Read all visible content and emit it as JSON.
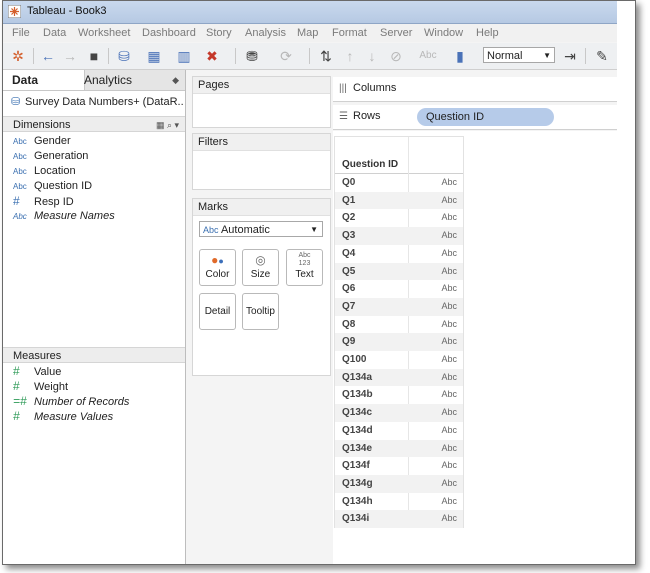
{
  "window": {
    "title": "Tableau - Book3"
  },
  "menu": [
    "File",
    "Data",
    "Worksheet",
    "Dashboard",
    "Story",
    "Analysis",
    "Map",
    "Format",
    "Server",
    "Window",
    "Help"
  ],
  "toolbar": {
    "fit_value": "Normal",
    "icons": [
      "tableau-logo-icon",
      "back-icon",
      "forward-icon",
      "save-icon",
      "new-datasource-icon",
      "new-worksheet-icon",
      "duplicate-sheet-icon",
      "clear-sheet-icon",
      "datasource-connect-icon",
      "refresh-icon",
      "swap-icon",
      "sort-ascending-icon",
      "sort-descending-icon",
      "group-icon",
      "labels-icon",
      "show-me-icon",
      "fit-icon",
      "pen-icon"
    ]
  },
  "left": {
    "tabs": {
      "data": "Data",
      "analytics": "Analytics"
    },
    "datasource": "Survey Data Numbers+ (DataR...",
    "dimensions_header": "Dimensions",
    "dimensions": [
      {
        "type": "Abc",
        "name": "Gender",
        "italic": false
      },
      {
        "type": "Abc",
        "name": "Generation",
        "italic": false
      },
      {
        "type": "Abc",
        "name": "Location",
        "italic": false
      },
      {
        "type": "Abc",
        "name": "Question ID",
        "italic": false
      },
      {
        "type": "#",
        "name": "Resp ID",
        "italic": false
      },
      {
        "type": "Abc",
        "name": "Measure Names",
        "italic": true
      }
    ],
    "measures_header": "Measures",
    "measures": [
      {
        "type": "#",
        "name": "Value",
        "italic": false
      },
      {
        "type": "#",
        "name": "Weight",
        "italic": false
      },
      {
        "type": "=#",
        "name": "Number of Records",
        "italic": true
      },
      {
        "type": "#",
        "name": "Measure Values",
        "italic": true
      }
    ]
  },
  "cards": {
    "pages": "Pages",
    "filters": "Filters",
    "marks": "Marks",
    "mark_type_icon": "Abc",
    "mark_type": "Automatic",
    "buttons": {
      "color": "Color",
      "size": "Size",
      "text": "Text",
      "detail": "Detail",
      "tooltip": "Tooltip"
    },
    "text_icon_lines": [
      "Abc",
      "123"
    ]
  },
  "shelves": {
    "columns_label": "Columns",
    "rows_label": "Rows",
    "rows_pill": "Question ID"
  },
  "view": {
    "header": "Question ID",
    "cell_placeholder": "Abc",
    "rows": [
      "Q0",
      "Q1",
      "Q2",
      "Q3",
      "Q4",
      "Q5",
      "Q6",
      "Q7",
      "Q8",
      "Q9",
      "Q100",
      "Q134a",
      "Q134b",
      "Q134c",
      "Q134d",
      "Q134e",
      "Q134f",
      "Q134g",
      "Q134h",
      "Q134i"
    ]
  }
}
